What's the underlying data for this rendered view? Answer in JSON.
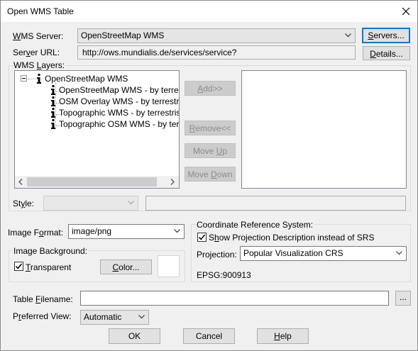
{
  "window": {
    "title": "Open WMS Table"
  },
  "wms_server": {
    "label": "WMS Server:",
    "value": "OpenStreetMap WMS",
    "servers_button": "Servers...",
    "url_label": "Server URL:",
    "url_value": "http://ows.mundialis.de/services/service?",
    "details_button": "Details..."
  },
  "layers": {
    "label": "WMS Layers:",
    "root": "OpenStreetMap WMS",
    "items": [
      "OpenStreetMap WMS - by terrestris",
      "OSM Overlay WMS - by terrestris",
      "Topographic WMS - by terrestris",
      "Topographic OSM WMS - by terrestris"
    ],
    "add_button": "Add>>",
    "remove_button": "Remove<<",
    "move_up_button": "Move Up",
    "move_down_button": "Move Down",
    "style_label": "Style:",
    "style_value": ""
  },
  "image_format": {
    "label": "Image Format:",
    "value": "image/png"
  },
  "image_background": {
    "label": "Image Background:",
    "transparent_label": "Transparent",
    "transparent_checked": true,
    "color_button": "Color...",
    "swatch_color": "#ffffff"
  },
  "crs": {
    "label": "Coordinate Reference System:",
    "show_desc_label": "Show Projection Description instead of SRS",
    "show_desc_checked": true,
    "projection_label": "Projection:",
    "projection_value": "Popular Visualization CRS",
    "epsg": "EPSG:900913"
  },
  "table_filename": {
    "label": "Table Filename:",
    "value": "",
    "browse_button": "..."
  },
  "preferred_view": {
    "label": "Preferred View:",
    "value": "Automatic"
  },
  "footer": {
    "ok": "OK",
    "cancel": "Cancel",
    "help": "Help"
  },
  "colors": {
    "accent": "#0078d7",
    "background": "#f0f0f0",
    "disabled_text": "#8c8c8c"
  }
}
